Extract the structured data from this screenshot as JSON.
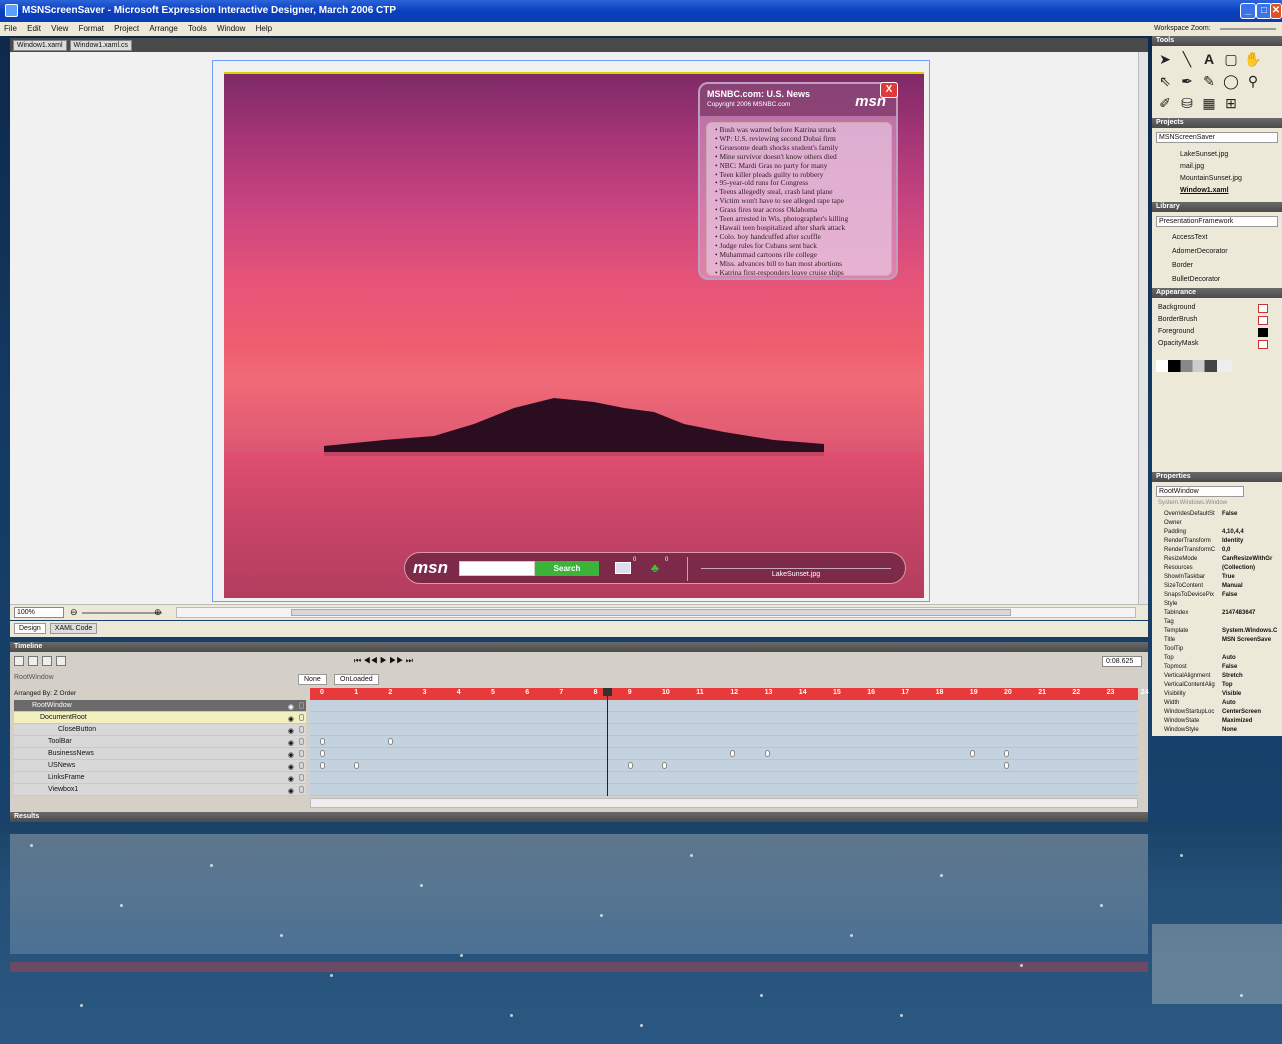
{
  "window": {
    "title": "MSNScreenSaver - Microsoft Expression Interactive Designer, March 2006 CTP",
    "min": "_",
    "max": "□",
    "close": "✕"
  },
  "menu": [
    "File",
    "Edit",
    "View",
    "Format",
    "Project",
    "Arrange",
    "Tools",
    "Window",
    "Help"
  ],
  "workspace_zoom_label": "Workspace Zoom:",
  "doc_tabs": [
    "Window1.xaml",
    "Window1.xaml.cs"
  ],
  "news": {
    "title": "MSNBC.com: U.S. News",
    "copyright": "Copyright 2006 MSNBC.com",
    "logo": "msn",
    "close": "X",
    "items": [
      "Bush was warned before Katrina struck",
      "WP: U.S. reviewing second Dubai firm",
      "Gruesome death shocks student's family",
      "Mine survivor doesn't know others died",
      "NBC: Mardi Gras no party for many",
      "Teen killer pleads guilty to robbery",
      "95-year-old runs for Congress",
      "Teens allegedly steal, crash land plane",
      "Victim won't have to see alleged rape tape",
      "Grass fires tear across Oklahoma",
      "Teen arrested in Wis. photographer's killing",
      "Hawaii teen hospitalized after shark attack",
      "Colo. boy handcuffed after scuffle",
      "Judge rules for Cubans sent back",
      "Muhammad cartoons rile college",
      "Miss. advances bill to ban most abortions",
      "Katrina first-responders leave cruise ships"
    ]
  },
  "toolbar": {
    "logo": "msn",
    "search_label": "Search",
    "mail_count": "0",
    "buddy_count": "0",
    "filename": "LakeSunset.jpg"
  },
  "zoom": {
    "value": "100%"
  },
  "view_tabs": [
    "Design",
    "XAML Code"
  ],
  "timeline": {
    "header": "Timeline",
    "scope": "RootWindow",
    "storyboards": [
      "None",
      "OnLoaded"
    ],
    "arranged_by": "Arranged By: Z Order",
    "time": "0:08.625",
    "ticks": [
      "0",
      "1",
      "2",
      "3",
      "4",
      "5",
      "6",
      "7",
      "8",
      "9",
      "10",
      "11",
      "12",
      "13",
      "14",
      "15",
      "16",
      "17",
      "18",
      "19",
      "20",
      "21",
      "22",
      "23",
      "24"
    ],
    "rows": [
      "RootWindow",
      "DocumentRoot",
      "CloseButton",
      "ToolBar",
      "BusinessNews",
      "USNews",
      "LinksFrame",
      "Viewbox1"
    ]
  },
  "results_header": "Results",
  "panels": {
    "tools": "Tools",
    "projects": {
      "header": "Projects",
      "root": "MSNScreenSaver",
      "files": [
        "LakeSunset.jpg",
        "mail.jpg",
        "MountainSunset.jpg",
        "Window1.xaml"
      ]
    },
    "library": {
      "header": "Library",
      "framework": "PresentationFramework",
      "items": [
        "AccessText",
        "AdornerDecorator",
        "Border",
        "BulletDecorator"
      ]
    },
    "appearance": {
      "header": "Appearance",
      "props": [
        "Background",
        "BorderBrush",
        "Foreground",
        "OpacityMask"
      ]
    },
    "properties": {
      "header": "Properties",
      "name": "RootWindow",
      "type": "System.Windows.Window",
      "rows": [
        [
          "OverridesDefaultSt",
          "False"
        ],
        [
          "Owner",
          ""
        ],
        [
          "Padding",
          "4,10,4,4"
        ],
        [
          "RenderTransform",
          "Identity"
        ],
        [
          "RenderTransformC",
          "0,0"
        ],
        [
          "ResizeMode",
          "CanResizeWithGr"
        ],
        [
          "Resources",
          "(Collection)"
        ],
        [
          "ShowInTaskbar",
          "True"
        ],
        [
          "SizeToContent",
          "Manual"
        ],
        [
          "SnapsToDevicePix",
          "False"
        ],
        [
          "Style",
          ""
        ],
        [
          "TabIndex",
          "2147483647"
        ],
        [
          "Tag",
          ""
        ],
        [
          "Template",
          "System.Windows.C"
        ],
        [
          "Title",
          "MSN ScreenSave"
        ],
        [
          "ToolTip",
          ""
        ],
        [
          "Top",
          "Auto"
        ],
        [
          "Topmost",
          "False"
        ],
        [
          "VerticalAlignment",
          "Stretch"
        ],
        [
          "VerticalContentAlig",
          "Top"
        ],
        [
          "Visibility",
          "Visible"
        ],
        [
          "Width",
          "Auto"
        ],
        [
          "WindowStartupLoc",
          "CenterScreen"
        ],
        [
          "WindowState",
          "Maximized"
        ],
        [
          "WindowStyle",
          "None"
        ]
      ]
    }
  },
  "colors": {
    "title_bar": "#0a3fc0",
    "ruler": "#e83a3a",
    "accent": "#3cb43c"
  }
}
